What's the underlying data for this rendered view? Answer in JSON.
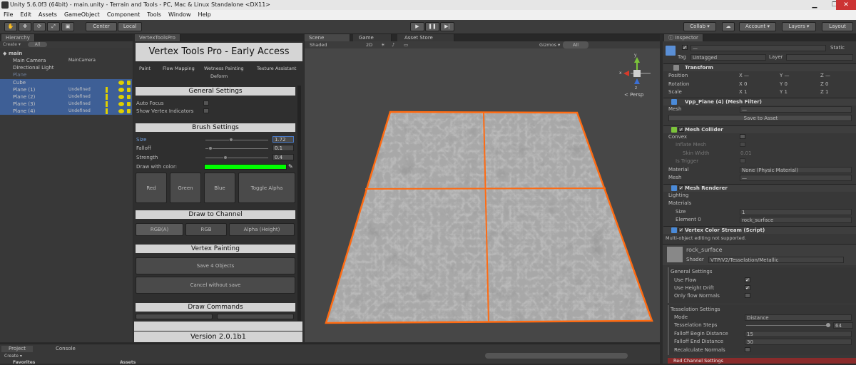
{
  "window": {
    "title": "Unity 5.6.0f3 (64bit) - main.unity - Terrain and Tools - PC, Mac & Linux Standalone <DX11>",
    "min": "▁",
    "max": "❐",
    "close": "✕"
  },
  "menu": [
    "File",
    "Edit",
    "Assets",
    "GameObject",
    "Component",
    "Tools",
    "Window",
    "Help"
  ],
  "toolbar": {
    "center": "Center",
    "local": "Local",
    "collab": "Collab ▾",
    "account": "Account ▾",
    "layers": "Layers ▾",
    "layout": "Layout"
  },
  "hierarchy": {
    "tab": "Hierarchy",
    "create": "Create ▾",
    "search": "All",
    "scene": "main",
    "items": [
      {
        "name": "Main Camera",
        "tag": "MainCamera",
        "selected": false,
        "dim": false,
        "warn": false
      },
      {
        "name": "Directional Light",
        "tag": "",
        "selected": false,
        "dim": false,
        "warn": false
      },
      {
        "name": "Plane",
        "tag": "",
        "selected": false,
        "dim": true,
        "warn": false
      },
      {
        "name": "Cube",
        "tag": "",
        "selected": true,
        "dim": false,
        "warn": false
      },
      {
        "name": "Plane (1)",
        "tag": "Undefined",
        "selected": true,
        "dim": false,
        "warn": true
      },
      {
        "name": "Plane (2)",
        "tag": "Undefined",
        "selected": true,
        "dim": false,
        "warn": true
      },
      {
        "name": "Plane (3)",
        "tag": "Undefined",
        "selected": true,
        "dim": false,
        "warn": true
      },
      {
        "name": "Plane (4)",
        "tag": "Undefined",
        "selected": true,
        "dim": false,
        "warn": true
      }
    ]
  },
  "vtp": {
    "tab": "VertexToolsPro",
    "header": "Vertex Tools Pro - Early Access",
    "tabs": [
      "Paint",
      "Flow Mapping",
      "Wetness Painting",
      "Texture Assistant",
      "Deform"
    ],
    "general": {
      "title": "General Settings",
      "auto_focus": "Auto Focus",
      "show_indicators": "Show Vertex Indicators"
    },
    "brush": {
      "title": "Brush Settings",
      "size_label": "Size",
      "size_value": "1.72",
      "falloff_label": "Falloff",
      "falloff_value": "0.1",
      "strength_label": "Strength",
      "strength_value": "0.4",
      "color_label": "Draw with color:",
      "color": "#00ff00",
      "size_frac": 0.4,
      "falloff_frac": 0.05,
      "strength_frac": 0.3
    },
    "channel_buttons": [
      "Red",
      "Green",
      "Blue",
      "Toggle Alpha"
    ],
    "draw_channel": {
      "title": "Draw to Channel",
      "options": [
        "RGB(A)",
        "RGB",
        "Alpha (Height)"
      ]
    },
    "vertex_painting": {
      "title": "Vertex Painting",
      "save": "Save 4 Objects",
      "cancel": "Cancel without save"
    },
    "draw_commands": {
      "title": "Draw Commands"
    },
    "version": "Version 2.0.1b1"
  },
  "scene": {
    "tab": "Scene",
    "game_tab": "Game",
    "asset_store_tab": "Asset Store",
    "shaded": "Shaded",
    "mode2d": "2D",
    "gizmos": "Gizmos ▾",
    "search": "All",
    "persp": "< Persp",
    "axis_x": "x",
    "axis_y": "y",
    "axis_z": "z"
  },
  "bottom": {
    "project_tab": "Project",
    "console_tab": "Console",
    "create": "Create ▾",
    "favorites": "Favorites",
    "assets": "Assets"
  },
  "inspector": {
    "tab": "Inspector",
    "static": "Static",
    "tag_label": "Tag",
    "tag_value": "Untagged",
    "layer_label": "Layer",
    "transform": {
      "title": "Transform",
      "position": "Position",
      "rotation": "Rotation",
      "scale": "Scale",
      "pos": [
        "X —",
        "Y —",
        "Z —"
      ],
      "rot": [
        "X 0",
        "Y 0",
        "Z 0"
      ],
      "scl": [
        "X 1",
        "Y 1",
        "Z 1"
      ]
    },
    "mesh_filter": {
      "title": "Vpp_Plane (4) (Mesh Filter)",
      "mesh_label": "Mesh",
      "mesh_value": "—",
      "save_asset": "Save to Asset"
    },
    "mesh_collider": {
      "title": "Mesh Collider",
      "convex": "Convex",
      "inflate": "Inflate Mesh",
      "skin": "Skin Width",
      "skin_value": "0.01",
      "trigger": "Is Trigger",
      "material_label": "Material",
      "material_value": "None (Physic Material)",
      "mesh_label": "Mesh",
      "mesh_value": "—"
    },
    "mesh_renderer": {
      "title": "Mesh Renderer",
      "lighting": "Lighting",
      "materials": "Materials",
      "size_label": "Size",
      "size_value": "1",
      "elem_label": "Element 0",
      "elem_value": "rock_surface"
    },
    "color_stream": {
      "title": "Vertex Color Stream (Script)",
      "note": "Multi-object editing not supported."
    },
    "material": {
      "name": "rock_surface",
      "shader_label": "Shader",
      "shader_value": "VTP/V2/Tesselation/Metallic"
    },
    "general_settings": {
      "title": "General Settings",
      "use_flow": "Use Flow",
      "use_height": "Use Height Drift",
      "only_flow": "Only flow Normals"
    },
    "tesselation": {
      "title": "Tesselation Settings",
      "mode_label": "Mode",
      "mode_value": "Distance",
      "steps_label": "Tesselation Steps",
      "steps_value": "64",
      "begin_label": "Falloff Begin Distance",
      "begin_value": "15",
      "end_label": "Falloff End Distance",
      "end_value": "30",
      "recalc_label": "Recalculate Normals"
    },
    "red_channel": "Red Channel Settings"
  }
}
